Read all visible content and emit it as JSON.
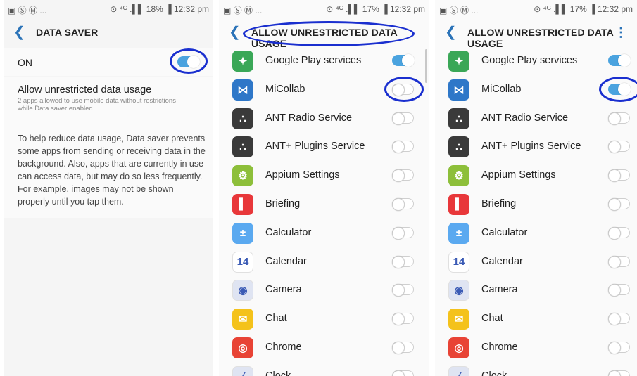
{
  "panels": [
    {
      "status": {
        "left": "▣ Ⓢ Ⓜ ...",
        "right": "⊙ ⁴ᴳ .▌▌ 18% ▐ 12:32 pm"
      },
      "title": "DATA SAVER",
      "on_label": "ON",
      "on_state": "on",
      "allow_title": "Allow unrestricted data usage",
      "allow_sub": "2 apps allowed to use mobile data without restrictions while Data saver enabled",
      "description": "To help reduce data usage, Data saver prevents some apps from sending or receiving data in the background. Also, apps that are currently in use can access data, but may do so less frequently. For example, images may not be shown properly until you tap them."
    },
    {
      "status": {
        "left": "▣ Ⓢ Ⓜ ...",
        "right": "⊙ ⁴ᴳ .▌▌ 17% ▐ 12:32 pm"
      },
      "title": "ALLOW UNRESTRICTED DATA USAGE",
      "apps": [
        {
          "name": "Google Play services",
          "icon": "google-play-services-icon",
          "glyph": "✦",
          "color": "#3aa757",
          "state": "on"
        },
        {
          "name": "MiCollab",
          "icon": "micollab-icon",
          "glyph": "⋈",
          "color": "#2e77c8",
          "state": "off"
        },
        {
          "name": "ANT Radio Service",
          "icon": "ant-radio-icon",
          "glyph": "∴",
          "color": "#3a3a3a",
          "state": "off"
        },
        {
          "name": "ANT+ Plugins Service",
          "icon": "ant-plus-icon",
          "glyph": "∴",
          "color": "#3a3a3a",
          "state": "off"
        },
        {
          "name": "Appium Settings",
          "icon": "appium-settings-icon",
          "glyph": "⚙",
          "color": "#8dbf3a",
          "state": "off"
        },
        {
          "name": "Briefing",
          "icon": "briefing-icon",
          "glyph": "▌",
          "color": "#e8373a",
          "state": "off"
        },
        {
          "name": "Calculator",
          "icon": "calculator-icon",
          "glyph": "±",
          "color": "#5aa9f0",
          "state": "off"
        },
        {
          "name": "Calendar",
          "icon": "calendar-icon",
          "glyph": "14",
          "color": "#ffffff",
          "state": "off"
        },
        {
          "name": "Camera",
          "icon": "camera-icon",
          "glyph": "◉",
          "color": "#dfe4f2",
          "state": "off"
        },
        {
          "name": "Chat",
          "icon": "chat-icon",
          "glyph": "✉",
          "color": "#f4c21b",
          "state": "off"
        },
        {
          "name": "Chrome",
          "icon": "chrome-icon",
          "glyph": "◎",
          "color": "#e84335",
          "state": "off"
        },
        {
          "name": "Clock",
          "icon": "clock-icon",
          "glyph": "∕",
          "color": "#dfe4f2",
          "state": "off"
        }
      ]
    },
    {
      "status": {
        "left": "▣ Ⓢ Ⓜ ...",
        "right": "⊙ ⁴ᴳ .▌▌ 17% ▐ 12:32 pm"
      },
      "title": "ALLOW UNRESTRICTED DATA USAGE",
      "more_icon": "⋮",
      "apps": [
        {
          "name": "Google Play services",
          "icon": "google-play-services-icon",
          "glyph": "✦",
          "color": "#3aa757",
          "state": "on"
        },
        {
          "name": "MiCollab",
          "icon": "micollab-icon",
          "glyph": "⋈",
          "color": "#2e77c8",
          "state": "on"
        },
        {
          "name": "ANT Radio Service",
          "icon": "ant-radio-icon",
          "glyph": "∴",
          "color": "#3a3a3a",
          "state": "off"
        },
        {
          "name": "ANT+ Plugins Service",
          "icon": "ant-plus-icon",
          "glyph": "∴",
          "color": "#3a3a3a",
          "state": "off"
        },
        {
          "name": "Appium Settings",
          "icon": "appium-settings-icon",
          "glyph": "⚙",
          "color": "#8dbf3a",
          "state": "off"
        },
        {
          "name": "Briefing",
          "icon": "briefing-icon",
          "glyph": "▌",
          "color": "#e8373a",
          "state": "off"
        },
        {
          "name": "Calculator",
          "icon": "calculator-icon",
          "glyph": "±",
          "color": "#5aa9f0",
          "state": "off"
        },
        {
          "name": "Calendar",
          "icon": "calendar-icon",
          "glyph": "14",
          "color": "#ffffff",
          "state": "off"
        },
        {
          "name": "Camera",
          "icon": "camera-icon",
          "glyph": "◉",
          "color": "#dfe4f2",
          "state": "off"
        },
        {
          "name": "Chat",
          "icon": "chat-icon",
          "glyph": "✉",
          "color": "#f4c21b",
          "state": "off"
        },
        {
          "name": "Chrome",
          "icon": "chrome-icon",
          "glyph": "◎",
          "color": "#e84335",
          "state": "off"
        },
        {
          "name": "Clock",
          "icon": "clock-icon",
          "glyph": "∕",
          "color": "#dfe4f2",
          "state": "off"
        }
      ]
    }
  ],
  "colors": {
    "accent": "#4aa3df",
    "highlight_oval": "#1a2fcf",
    "back_arrow": "#2b73b8"
  }
}
